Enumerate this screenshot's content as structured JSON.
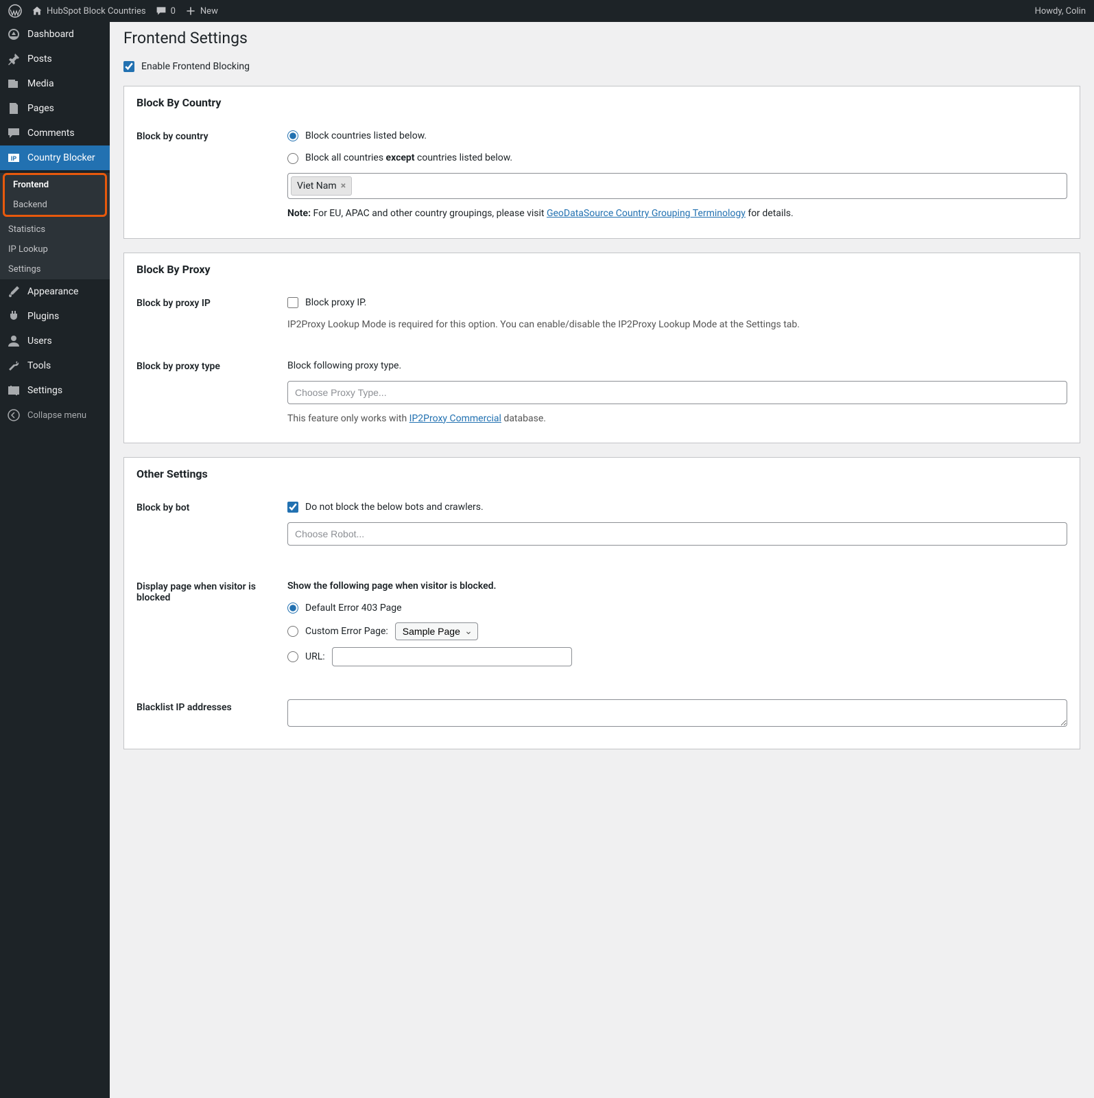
{
  "adminbar": {
    "site_title": "HubSpot Block Countries",
    "comment_count": "0",
    "new_label": "New",
    "howdy": "Howdy, Colin"
  },
  "sidebar": {
    "items": [
      {
        "label": "Dashboard"
      },
      {
        "label": "Posts"
      },
      {
        "label": "Media"
      },
      {
        "label": "Pages"
      },
      {
        "label": "Comments"
      },
      {
        "label": "Country Blocker"
      },
      {
        "label": "Appearance"
      },
      {
        "label": "Plugins"
      },
      {
        "label": "Users"
      },
      {
        "label": "Tools"
      },
      {
        "label": "Settings"
      }
    ],
    "submenu": [
      {
        "label": "Frontend"
      },
      {
        "label": "Backend"
      },
      {
        "label": "Statistics"
      },
      {
        "label": "IP Lookup"
      },
      {
        "label": "Settings"
      }
    ],
    "collapse": "Collapse menu"
  },
  "page": {
    "title": "Frontend Settings",
    "enable_checkbox": "Enable Frontend Blocking"
  },
  "block_country": {
    "heading": "Block By Country",
    "label": "Block by country",
    "radio1": "Block countries listed below.",
    "radio2a": "Block all countries ",
    "radio2b": "except",
    "radio2c": " countries listed below.",
    "tag": "Viet Nam",
    "note_label": "Note: ",
    "note_text1": "For EU, APAC and other country groupings, please visit ",
    "note_link": "GeoDataSource Country Grouping Terminology",
    "note_text2": " for details."
  },
  "block_proxy": {
    "heading": "Block By Proxy",
    "label_ip": "Block by proxy IP",
    "check_ip": "Block proxy IP.",
    "help_ip": "IP2Proxy Lookup Mode is required for this option. You can enable/disable the IP2Proxy Lookup Mode at the Settings tab.",
    "label_type": "Block by proxy type",
    "type_text": "Block following proxy type.",
    "type_placeholder": "Choose Proxy Type...",
    "type_help1": "This feature only works with ",
    "type_link": "IP2Proxy Commercial",
    "type_help2": " database."
  },
  "other": {
    "heading": "Other Settings",
    "bot_label": "Block by bot",
    "bot_check": "Do not block the below bots and crawlers.",
    "bot_placeholder": "Choose Robot...",
    "display_label": "Display page when visitor is blocked",
    "display_title": "Show the following page when visitor is blocked.",
    "radio_default": "Default Error 403 Page",
    "radio_custom": "Custom Error Page:",
    "custom_option": "Sample Page",
    "radio_url": "URL:",
    "blacklist_label": "Blacklist IP addresses"
  }
}
